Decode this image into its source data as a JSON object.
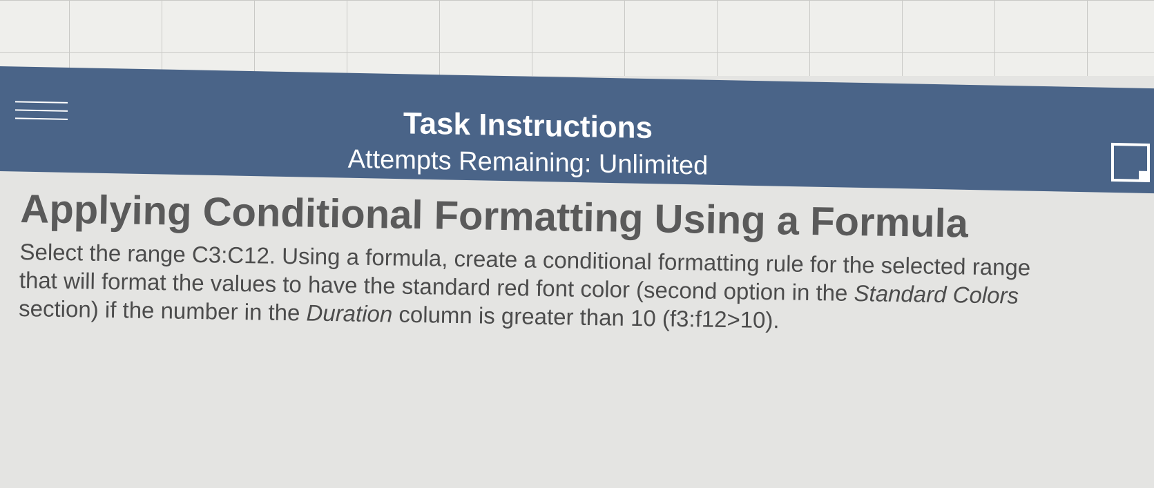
{
  "header": {
    "title": "Task Instructions",
    "subtitle": "Attempts Remaining: Unlimited",
    "menu_icon": "hamburger-menu-icon",
    "expand_icon": "expand-icon",
    "background_color": "#4a6488"
  },
  "task": {
    "title": "Applying Conditional Formatting Using a Formula",
    "body_part1": "Select the range C3:C12. Using a formula, create a conditional formatting rule for the selected range that will format the values to have the standard red font color (second option in the ",
    "body_em1": "Standard Colors",
    "body_part2": " section) if the number in the ",
    "body_em2": "Duration",
    "body_part3": " column is greater than 10 (f3:f12>10)."
  }
}
